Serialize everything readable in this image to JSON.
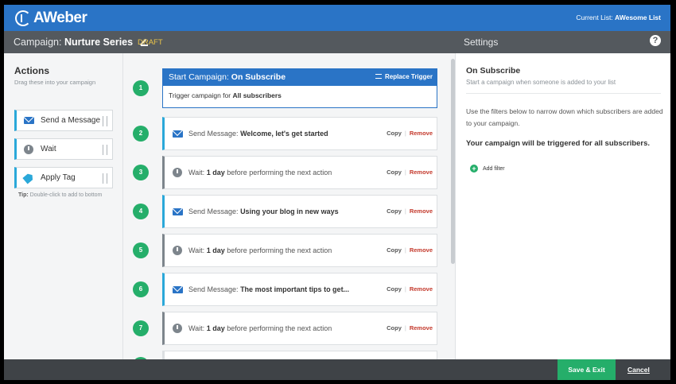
{
  "header": {
    "logo_text": "AWeber",
    "current_list_label": "Current List:",
    "current_list_value": "AWesome List"
  },
  "subheader": {
    "campaign_label": "Campaign:",
    "campaign_name": "Nurture Series",
    "status": "DRAFT",
    "settings_title": "Settings",
    "help_glyph": "?"
  },
  "actions_panel": {
    "heading": "Actions",
    "subheading": "Drag these into your campaign",
    "items": [
      {
        "label": "Send a Message",
        "icon": "envelope-icon"
      },
      {
        "label": "Wait",
        "icon": "clock-icon"
      },
      {
        "label": "Apply Tag",
        "icon": "tag-icon"
      }
    ],
    "tip_label": "Tip:",
    "tip_text": "Double-click to add to bottom"
  },
  "workflow": {
    "trigger": {
      "number": "1",
      "prefix": "Start Campaign:",
      "name": "On Subscribe",
      "replace_label": "Replace Trigger",
      "body_prefix": "Trigger campaign for",
      "body_value": "All subscribers"
    },
    "copy_label": "Copy",
    "remove_label": "Remove",
    "steps": [
      {
        "number": "2",
        "type": "message",
        "prefix": "Send Message:",
        "value": "Welcome, let's get started",
        "suffix": ""
      },
      {
        "number": "3",
        "type": "wait",
        "prefix": "Wait:",
        "value": "1 day",
        "suffix": "before performing the next action"
      },
      {
        "number": "4",
        "type": "message",
        "prefix": "Send Message:",
        "value": "Using your blog in new ways",
        "suffix": ""
      },
      {
        "number": "5",
        "type": "wait",
        "prefix": "Wait:",
        "value": "1 day",
        "suffix": "before performing the next action"
      },
      {
        "number": "6",
        "type": "message",
        "prefix": "Send Message:",
        "value": "The most important tips to get...",
        "suffix": ""
      },
      {
        "number": "7",
        "type": "wait",
        "prefix": "Wait:",
        "value": "1 day",
        "suffix": "before performing the next action"
      }
    ]
  },
  "settings_panel": {
    "title": "On Subscribe",
    "subtitle": "Start a campaign when someone is added to your list",
    "description": "Use the filters below to narrow down which subscribers are added to your campaign.",
    "trigger_note": "Your campaign will be triggered for all subscribers.",
    "add_filter_label": "Add filter"
  },
  "footer": {
    "save_label": "Save & Exit",
    "cancel_label": "Cancel"
  },
  "colors": {
    "brand_blue": "#2a74c6",
    "step_green": "#25ae6a",
    "message_accent": "#2aa8d9",
    "remove_red": "#c43a2d",
    "draft_yellow": "#e8c34a"
  }
}
